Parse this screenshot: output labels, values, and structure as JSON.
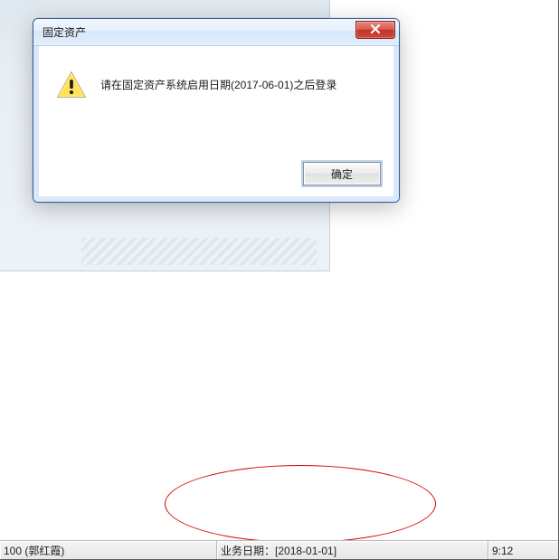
{
  "dialog": {
    "title": "固定资产",
    "message": "请在固定资产系统启用日期(2017-06-01)之后登录",
    "ok_label": "确定"
  },
  "statusbar": {
    "user_text": "100 (郭红霞)",
    "date_label": "业务日期：",
    "date_value": "[2018-01-01]",
    "time_text": "9:12"
  },
  "icons": {
    "close": "close-icon",
    "warning": "warning-triangle-icon"
  }
}
